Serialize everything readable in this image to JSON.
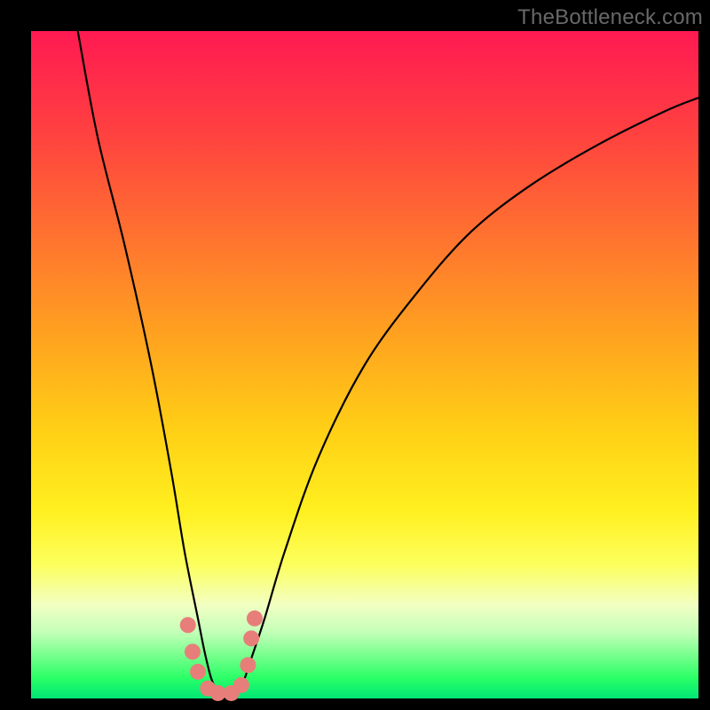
{
  "watermark": "TheBottleneck.com",
  "chart_data": {
    "type": "line",
    "title": "",
    "xlabel": "",
    "ylabel": "",
    "xlim": [
      0,
      100
    ],
    "ylim": [
      0,
      100
    ],
    "gradient_stops": [
      {
        "pos": 0,
        "color": "#ff1a52"
      },
      {
        "pos": 15,
        "color": "#ff4040"
      },
      {
        "pos": 30,
        "color": "#ff7030"
      },
      {
        "pos": 45,
        "color": "#ffa020"
      },
      {
        "pos": 60,
        "color": "#ffd015"
      },
      {
        "pos": 72,
        "color": "#fff020"
      },
      {
        "pos": 80,
        "color": "#fcff5e"
      },
      {
        "pos": 86,
        "color": "#f2ffc3"
      },
      {
        "pos": 90,
        "color": "#c4ffb8"
      },
      {
        "pos": 94,
        "color": "#6dff88"
      },
      {
        "pos": 97,
        "color": "#29ff66"
      },
      {
        "pos": 100,
        "color": "#00e676"
      }
    ],
    "series": [
      {
        "name": "bottleneck-curve",
        "x": [
          7,
          10,
          14,
          18,
          21,
          23,
          25,
          26,
          27,
          28,
          29,
          30,
          31,
          32,
          33,
          35,
          38,
          43,
          50,
          58,
          66,
          75,
          85,
          95,
          100
        ],
        "y": [
          100,
          84,
          68,
          50,
          34,
          22,
          12,
          7,
          3,
          1,
          0,
          0,
          1,
          3,
          6,
          12,
          22,
          36,
          50,
          61,
          70,
          77,
          83,
          88,
          90
        ]
      }
    ],
    "markers": {
      "name": "highlight-dots",
      "color": "#e77e7a",
      "points": [
        {
          "x": 23.5,
          "y": 11
        },
        {
          "x": 24.2,
          "y": 7
        },
        {
          "x": 25.0,
          "y": 4
        },
        {
          "x": 26.5,
          "y": 1.5
        },
        {
          "x": 28.0,
          "y": 0.8
        },
        {
          "x": 30.0,
          "y": 0.8
        },
        {
          "x": 31.5,
          "y": 2.0
        },
        {
          "x": 32.5,
          "y": 5.0
        },
        {
          "x": 33.0,
          "y": 9.0
        },
        {
          "x": 33.5,
          "y": 12.0
        }
      ]
    }
  }
}
